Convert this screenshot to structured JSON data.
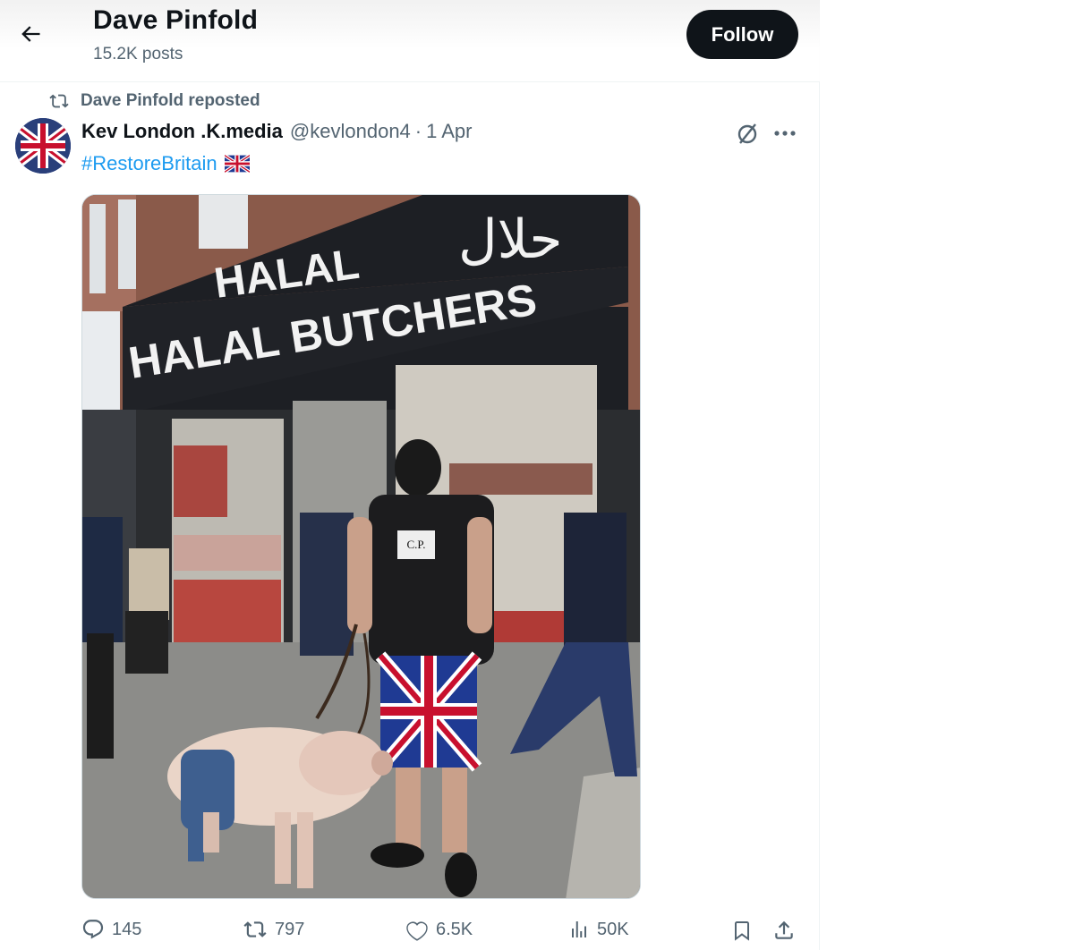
{
  "header": {
    "profile_name": "Dave Pinfold",
    "post_count": "15.2K posts",
    "follow_label": "Follow",
    "back_icon": "arrow-left-icon"
  },
  "repost": {
    "text": "Dave Pinfold reposted",
    "icon": "repost-icon"
  },
  "post": {
    "author_name": "Kev London .K.media",
    "handle": "@kevlondon4",
    "separator": "·",
    "date": "1 Apr",
    "hashtag": "#RestoreBritain",
    "flag": "union-jack-flag",
    "image": {
      "alt_description_visible": false,
      "shop_sign_line1": "HALAL",
      "shop_sign_line2": "HALAL BUTCHERS",
      "shop_sign_arabic": "حلال",
      "shirt_text": "C.P."
    }
  },
  "actions": {
    "replies": "145",
    "reposts": "797",
    "likes": "6.5K",
    "views": "50K"
  },
  "colors": {
    "accent": "#1d9bf0",
    "text_primary": "#0f1419",
    "text_secondary": "#536471",
    "button_bg": "#0f1419"
  }
}
